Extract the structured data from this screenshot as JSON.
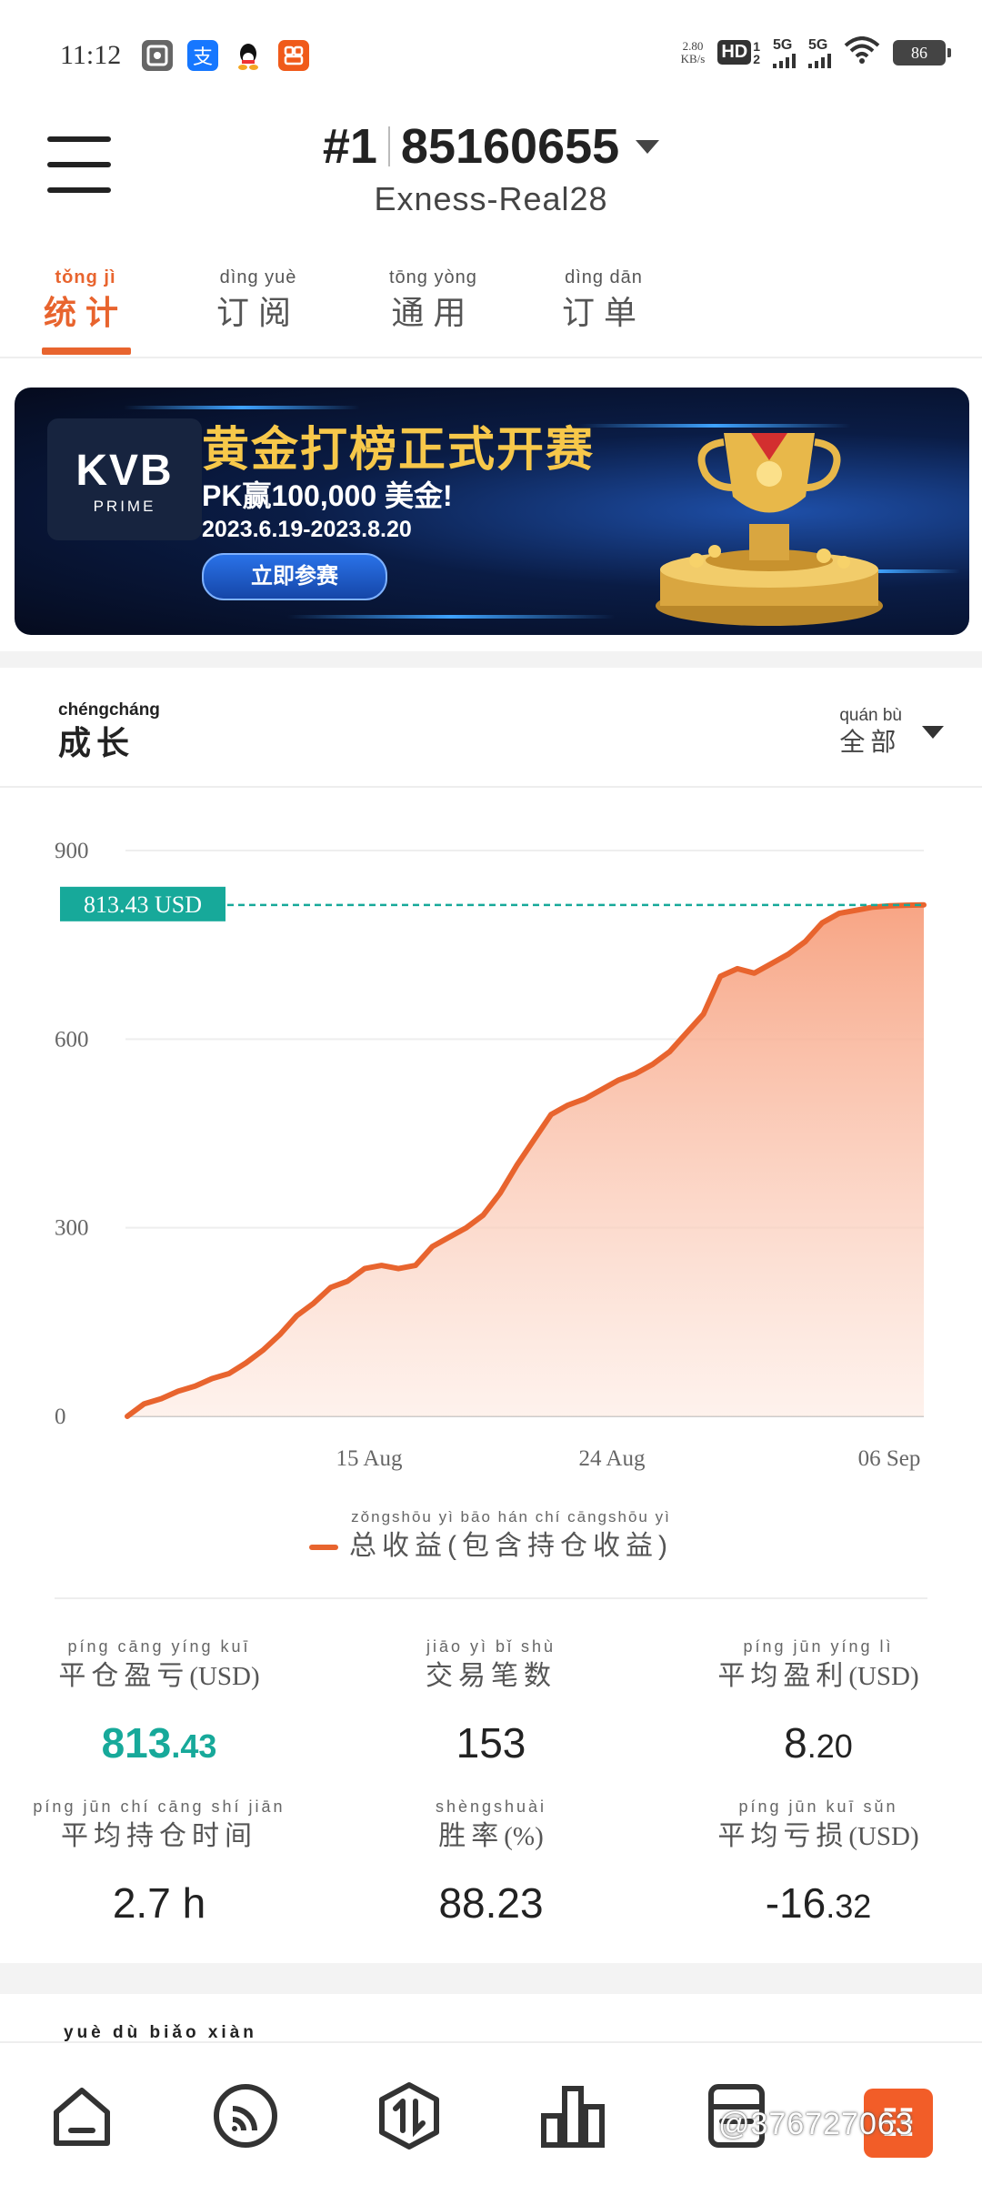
{
  "status_bar": {
    "time": "11:12",
    "net_speed_value": "2.80",
    "net_speed_unit": "KB/s",
    "hd_label": "HD",
    "hd_sub": "1",
    "hd_sub2": "2",
    "sim1": "5G",
    "sim2": "5G",
    "battery": "86",
    "app_icons": [
      "scan-app-icon",
      "alipay-icon",
      "qq-icon",
      "app-grid-icon"
    ]
  },
  "header": {
    "rank": "#1",
    "account": "85160655",
    "server": "Exness-Real28"
  },
  "tabs": [
    {
      "py": "tǒng  jì",
      "hz": "统计",
      "active": true
    },
    {
      "py": "dìng  yuè",
      "hz": "订阅",
      "active": false
    },
    {
      "py": "tōng yòng",
      "hz": "通用",
      "active": false
    },
    {
      "py": "dìng  dān",
      "hz": "订单",
      "active": false
    }
  ],
  "banner": {
    "logo_main": "KVB",
    "logo_sub": "PRIME",
    "title": "黄金打榜正式开赛",
    "subtitle": "PK赢100,000 美金!",
    "dates": "2023.6.19-2023.8.20",
    "button": "立即参赛"
  },
  "growth": {
    "title_py": "chéngcháng",
    "title_hz": "成长",
    "filter_py": "quán  bù",
    "filter_hz": "全部"
  },
  "chart_data": {
    "type": "area",
    "y_ticks": [
      "900",
      "600",
      "300",
      "0"
    ],
    "ylim": [
      0,
      900
    ],
    "x_ticks": [
      "15 Aug",
      "24 Aug",
      "06 Sep"
    ],
    "current_label": "813.43 USD",
    "current_value": 813.43,
    "series": [
      {
        "name": "总收益(包含持仓收益)",
        "color": "#e8642e",
        "values": [
          0,
          20,
          28,
          40,
          48,
          60,
          68,
          85,
          105,
          130,
          160,
          180,
          205,
          215,
          235,
          240,
          235,
          240,
          270,
          285,
          300,
          320,
          355,
          400,
          440,
          480,
          495,
          505,
          520,
          535,
          545,
          560,
          580,
          610,
          640,
          700,
          712,
          705,
          720,
          735,
          755,
          785,
          800,
          805,
          810,
          812,
          813,
          813.43
        ]
      }
    ]
  },
  "legend": {
    "py": "zǒngshōu  yì     bāo  hán   chí  cāngshōu  yì",
    "hz": "总收益(包含持仓收益)"
  },
  "stats": [
    {
      "py": "píng cāng yíng  kuī",
      "hz": "平仓盈亏",
      "unit": "(USD)",
      "int": "813",
      "dec": ".43",
      "green": true
    },
    {
      "py": "jiāo   yì    bǐ   shù",
      "hz": "交易笔数",
      "unit": "",
      "int": "153",
      "dec": "",
      "green": false
    },
    {
      "py": "píng  jūn  yíng   lì",
      "hz": "平均盈利",
      "unit": "(USD)",
      "int": "8",
      "dec": ".20",
      "green": false
    },
    {
      "py": "píng  jūn   chí cāng shí   jiān",
      "hz": "平均持仓时间",
      "unit": "",
      "int": "2.7 h",
      "dec": "",
      "green": false
    },
    {
      "py": "shèngshuài",
      "hz": "胜率",
      "unit": "(%)",
      "int": "88.23",
      "dec": "",
      "green": false
    },
    {
      "py": "píng  jūn   kuī  sǔn",
      "hz": "平均亏损",
      "unit": "(USD)",
      "int": "-16",
      "dec": ".32",
      "green": false
    }
  ],
  "next_section_py": "yuè   dù   biǎo  xiàn",
  "bottom_nav": [
    "home-icon",
    "feed-icon",
    "trade-icon",
    "chart-icon",
    "document-icon",
    "statistics-icon"
  ],
  "nav_active_glyph": "☷",
  "watermark": "@376727063"
}
